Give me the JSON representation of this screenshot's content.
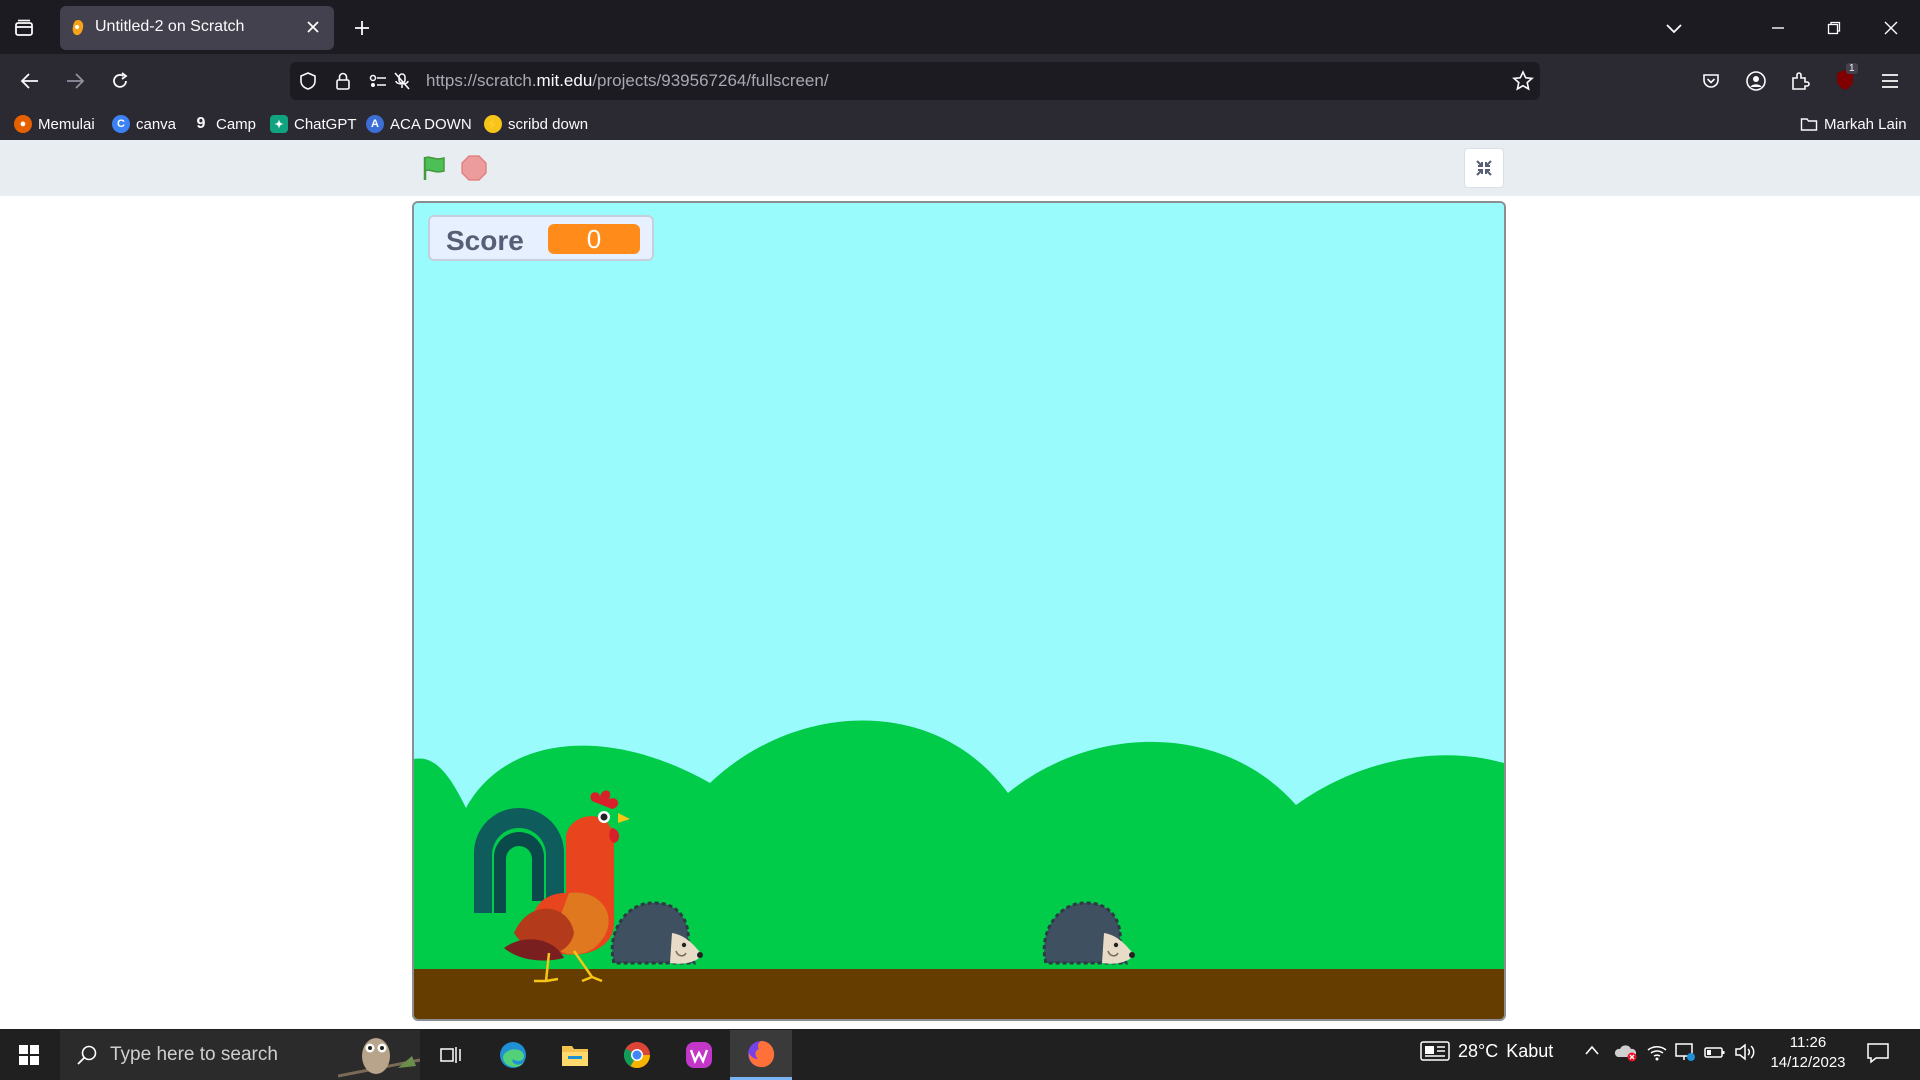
{
  "browser": {
    "tab_title": "Untitled-2 on Scratch",
    "url_prefix": "https://scratch.",
    "url_domain": "mit.edu",
    "url_path": "/projects/939567264/fullscreen/",
    "bookmarks": [
      {
        "label": "Memulai",
        "icon": "firefox-icon",
        "color": "#e66000"
      },
      {
        "label": "canva",
        "icon": "canva-icon",
        "color": "#3b82f6"
      },
      {
        "label": "Camp",
        "icon": "camp-icon",
        "color": "#9aa0a6"
      },
      {
        "label": "ChatGPT",
        "icon": "chatgpt-icon",
        "color": "#10a37f"
      },
      {
        "label": "ACA DOWN",
        "icon": "aca-icon",
        "color": "#3b6fd6"
      },
      {
        "label": "scribd down",
        "icon": "scribd-icon",
        "color": "#f5c518"
      }
    ],
    "other_bookmarks": "Markah Lain",
    "extension_badge": "1"
  },
  "scratch": {
    "score_label": "Score",
    "score_value": "0",
    "stage_colors": {
      "sky": "#9afbfc",
      "hills": "#00cc4a",
      "ground": "#663d00"
    }
  },
  "taskbar": {
    "search_placeholder": "Type here to search",
    "weather_temp": "28°C",
    "weather_desc": "Kabut",
    "time": "11:26",
    "date": "14/12/2023"
  }
}
